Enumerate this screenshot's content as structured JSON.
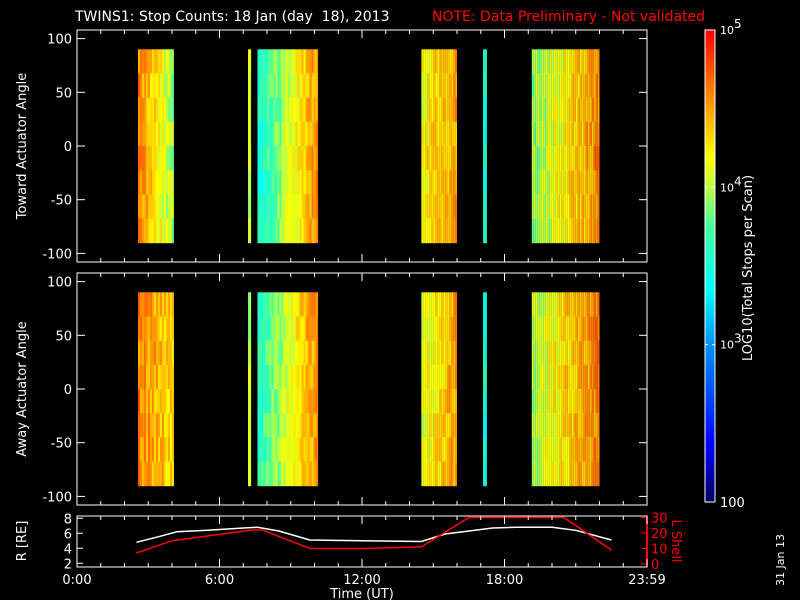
{
  "chart_data": [
    {
      "type": "heatmap",
      "title": "TWINS1: Stop Counts: 18 Jan (day  18), 2013",
      "note": "NOTE: Data Preliminary - Not validated",
      "panels": [
        {
          "ylabel": "Toward Actuator Angle",
          "ylim": [
            -108,
            108
          ],
          "yticks": [
            100,
            50,
            0,
            -50,
            -100
          ],
          "blocks": [
            {
              "start_h": 2.57,
              "end_h": 4.08,
              "left_log": 4.6,
              "right_log": 3.9
            },
            {
              "start_h": 7.2,
              "end_h": 7.33,
              "left_log": 4.0,
              "right_log": 4.0
            },
            {
              "start_h": 7.6,
              "end_h": 10.15,
              "left_log": 3.5,
              "right_log": 4.6
            },
            {
              "start_h": 14.5,
              "end_h": 16.0,
              "left_log": 4.2,
              "right_log": 4.5
            },
            {
              "start_h": 17.1,
              "end_h": 17.26,
              "left_log": 3.5,
              "right_log": 3.5
            },
            {
              "start_h": 19.15,
              "end_h": 22.0,
              "left_log": 3.9,
              "right_log": 4.6
            }
          ]
        },
        {
          "ylabel": "Away Actuator Angle",
          "ylim": [
            -108,
            108
          ],
          "yticks": [
            100,
            50,
            0,
            -50,
            -100
          ],
          "blocks": [
            {
              "start_h": 2.57,
              "end_h": 4.08,
              "left_log": 4.6,
              "right_log": 4.3
            },
            {
              "start_h": 7.2,
              "end_h": 7.33,
              "left_log": 4.0,
              "right_log": 4.0
            },
            {
              "start_h": 7.6,
              "end_h": 10.15,
              "left_log": 3.6,
              "right_log": 4.6
            },
            {
              "start_h": 14.5,
              "end_h": 16.0,
              "left_log": 4.1,
              "right_log": 4.5
            },
            {
              "start_h": 17.1,
              "end_h": 17.26,
              "left_log": 3.5,
              "right_log": 3.5
            },
            {
              "start_h": 19.15,
              "end_h": 22.0,
              "left_log": 4.0,
              "right_log": 4.6
            }
          ]
        }
      ],
      "colorbar": {
        "label": "LOG10(Total Stops per Scan)",
        "range_log": [
          2,
          5
        ],
        "ticks": [
          {
            "log": 5,
            "label": "10",
            "exp": "5"
          },
          {
            "log": 4,
            "label": "10",
            "exp": "4"
          },
          {
            "log": 3,
            "label": "10",
            "exp": "3"
          },
          {
            "log": 2,
            "label": "100",
            "exp": ""
          }
        ]
      }
    },
    {
      "type": "line",
      "xlabel": "Time (UT)",
      "xlim": [
        0,
        24
      ],
      "xticks": [
        {
          "h": 0,
          "label": "0:00"
        },
        {
          "h": 6,
          "label": "6:00"
        },
        {
          "h": 12,
          "label": "12:00"
        },
        {
          "h": 18,
          "label": "18:00"
        },
        {
          "h": 24,
          "label": "23:59"
        }
      ],
      "ylabel_left": "R [RE]",
      "ylim_left": [
        1.5,
        8.3
      ],
      "yticks_left": [
        2,
        4,
        6,
        8
      ],
      "ylabel_right": "L Shell",
      "ylim_right": [
        -2,
        31
      ],
      "yticks_right": [
        0,
        10,
        20,
        30
      ],
      "series": [
        {
          "name": "R",
          "color": "#ffffff",
          "axis": "left",
          "x": [
            2.5,
            3.5,
            4.2,
            5.5,
            7.0,
            7.6,
            8.5,
            9.8,
            12.0,
            14.5,
            15.5,
            16.5,
            17.5,
            18.5,
            20.0,
            21.0,
            22.5
          ],
          "y": [
            4.8,
            5.6,
            6.2,
            6.4,
            6.7,
            6.8,
            6.3,
            5.1,
            5.0,
            4.9,
            5.9,
            6.3,
            6.7,
            6.8,
            6.8,
            6.4,
            5.1
          ]
        },
        {
          "name": "L Shell",
          "color": "#ff0000",
          "axis": "right",
          "x": [
            2.5,
            4.0,
            7.4,
            7.8,
            9.8,
            12.0,
            14.5,
            16.5,
            20.5,
            22.5
          ],
          "y": [
            7,
            15,
            22,
            22,
            10,
            10,
            11,
            30,
            30,
            9
          ]
        }
      ]
    }
  ],
  "date_stamp": "31 Jan 13"
}
